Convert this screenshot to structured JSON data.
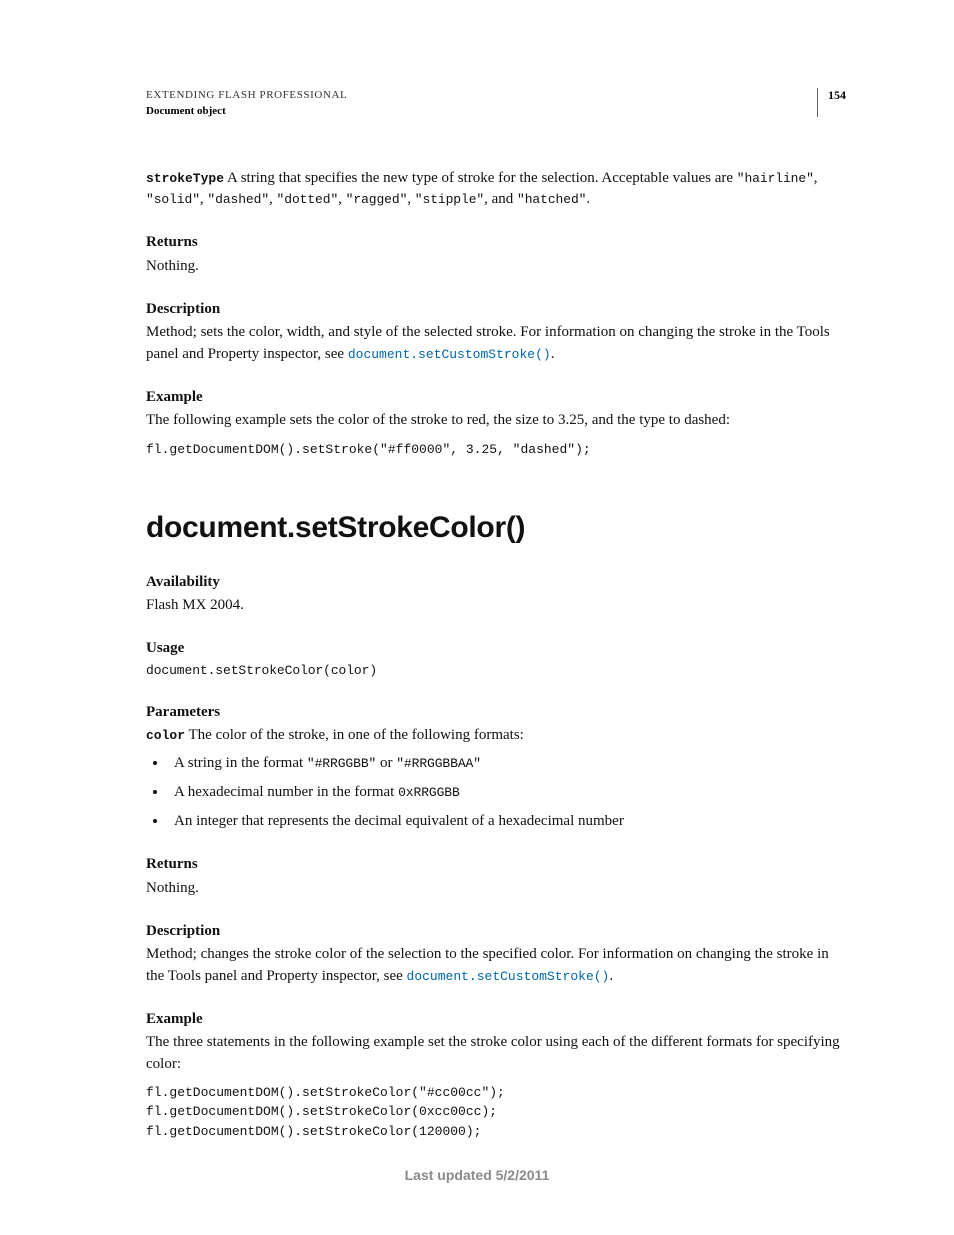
{
  "header": {
    "title": "EXTENDING FLASH PROFESSIONAL",
    "subtitle": "Document object",
    "page_number": "154"
  },
  "top_section": {
    "param_name": "strokeType",
    "param_desc_prefix": "  A string that specifies the new type of stroke for the selection. Acceptable values are ",
    "val1": "\"hairline\"",
    "comma1": ", ",
    "val2": "\"solid\"",
    "comma2": ", ",
    "val3": "\"dashed\"",
    "comma3": ", ",
    "val4": "\"dotted\"",
    "comma4": ", ",
    "val5": "\"ragged\"",
    "comma5": ", ",
    "val6": "\"stipple\"",
    "and": ", and ",
    "val7": "\"hatched\"",
    "period": ".",
    "returns_h": "Returns",
    "returns_text": "Nothing.",
    "desc_h": "Description",
    "desc_text_1": "Method; sets the color, width, and style of the selected stroke. For information on changing the stroke in the Tools panel and Property inspector, see ",
    "desc_link": "document.setCustomStroke()",
    "desc_period": ".",
    "example_h": "Example",
    "example_text": "The following example sets the color of the stroke to red, the size to 3.25, and the type to dashed:",
    "example_code": "fl.getDocumentDOM().setStroke(\"#ff0000\", 3.25, \"dashed\");"
  },
  "main": {
    "heading": "document.setStrokeColor()",
    "avail_h": "Availability",
    "avail_text": "Flash MX 2004.",
    "usage_h": "Usage",
    "usage_code": "document.setStrokeColor(color)",
    "params_h": "Parameters",
    "param_name": "color",
    "param_desc": "  The color of the stroke, in one of the following formats:",
    "bullet1_pre": "A string in the format ",
    "bullet1_code1": "\"#RRGGBB\"",
    "bullet1_or": " or ",
    "bullet1_code2": "\"#RRGGBBAA\"",
    "bullet2_pre": "A hexadecimal number in the format ",
    "bullet2_code": "0xRRGGBB",
    "bullet3": "An integer that represents the decimal equivalent of a hexadecimal number",
    "returns_h": "Returns",
    "returns_text": "Nothing.",
    "desc_h": "Description",
    "desc_text_1": "Method; changes the stroke color of the selection to the specified color. For information on changing the stroke in the Tools panel and Property inspector, see ",
    "desc_link": "document.setCustomStroke()",
    "desc_period": ".",
    "example_h": "Example",
    "example_text": "The three statements in the following example set the stroke color using each of the different formats for specifying color:",
    "example_code": "fl.getDocumentDOM().setStrokeColor(\"#cc00cc\");\nfl.getDocumentDOM().setStrokeColor(0xcc00cc);\nfl.getDocumentDOM().setStrokeColor(120000);"
  },
  "footer": {
    "text": "Last updated 5/2/2011"
  }
}
